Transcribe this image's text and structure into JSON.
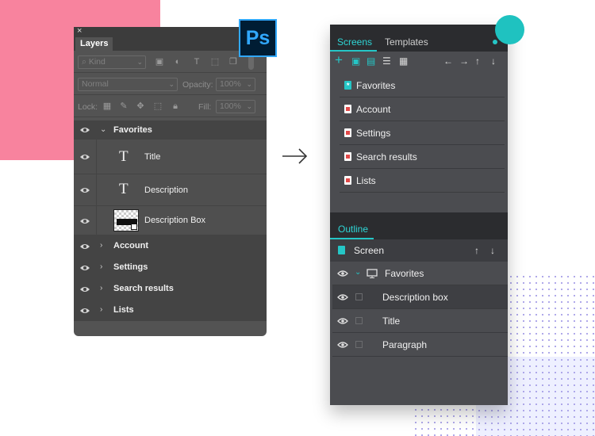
{
  "photoshop": {
    "tab_label": "Layers",
    "close_glyph": "×",
    "kind_placeholder": "Kind",
    "blend_mode": "Normal",
    "opacity_label": "Opacity:",
    "opacity_value": "100%",
    "lock_label": "Lock:",
    "fill_label": "Fill:",
    "fill_value": "100%",
    "layers": {
      "favorites": "Favorites",
      "title": "Title",
      "description": "Description",
      "description_box": "Description Box",
      "account": "Account",
      "settings": "Settings",
      "search_results": "Search results",
      "lists": "Lists"
    },
    "layer_type_glyph": "T",
    "logo_text": "Ps"
  },
  "screens_panel": {
    "tabs": {
      "screens": "Screens",
      "templates": "Templates"
    },
    "screens": [
      "Favorites",
      "Account",
      "Settings",
      "Search results",
      "Lists"
    ],
    "outline_tab": "Outline",
    "outline_header": "Screen",
    "outline_items": {
      "favorites": "Favorites",
      "description_box": "Description box",
      "title": "Title",
      "paragraph": "Paragraph"
    }
  },
  "colors": {
    "accent": "#25c6c6",
    "pink_block": "#f8839e",
    "ps_panel": "#535353",
    "right_panel": "#4b4c50"
  }
}
